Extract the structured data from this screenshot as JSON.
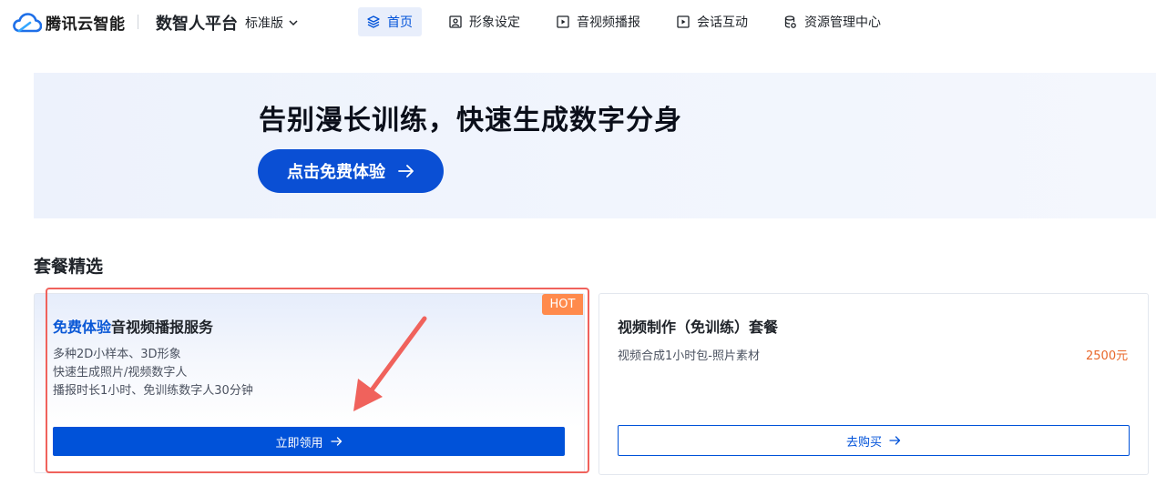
{
  "header": {
    "brand": "腾讯云智能",
    "platform": "数智人平台",
    "edition": "标准版",
    "nav": [
      {
        "label": "首页",
        "icon": "layers-icon",
        "active": true
      },
      {
        "label": "形象设定",
        "icon": "portrait-icon",
        "active": false
      },
      {
        "label": "音视频播报",
        "icon": "play-square-icon",
        "active": false
      },
      {
        "label": "会话互动",
        "icon": "play-square-icon",
        "active": false
      },
      {
        "label": "资源管理中心",
        "icon": "database-icon",
        "active": false
      }
    ]
  },
  "banner": {
    "title": "告别漫长训练，快速生成数字分身",
    "cta_label": "点击免费体验"
  },
  "section": {
    "title": "套餐精选"
  },
  "cards": [
    {
      "badge": "HOT",
      "title_accent": "免费体验",
      "title_rest": "音视频播报服务",
      "desc_lines": [
        "多种2D小样本、3D形象",
        "快速生成照片/视频数字人",
        "播报时长1小时、免训练数字人30分钟"
      ],
      "button_label": "立即领用"
    },
    {
      "title": "视频制作（免训练）套餐",
      "desc": "视频合成1小时包-照片素材",
      "price": "2500元",
      "button_label": "去购买"
    }
  ],
  "colors": {
    "primary": "#0052d9",
    "banner_button": "#0a4fd4",
    "hot": "#ff8a4c",
    "price": "#e8672a",
    "annotation": "#f0625c"
  }
}
